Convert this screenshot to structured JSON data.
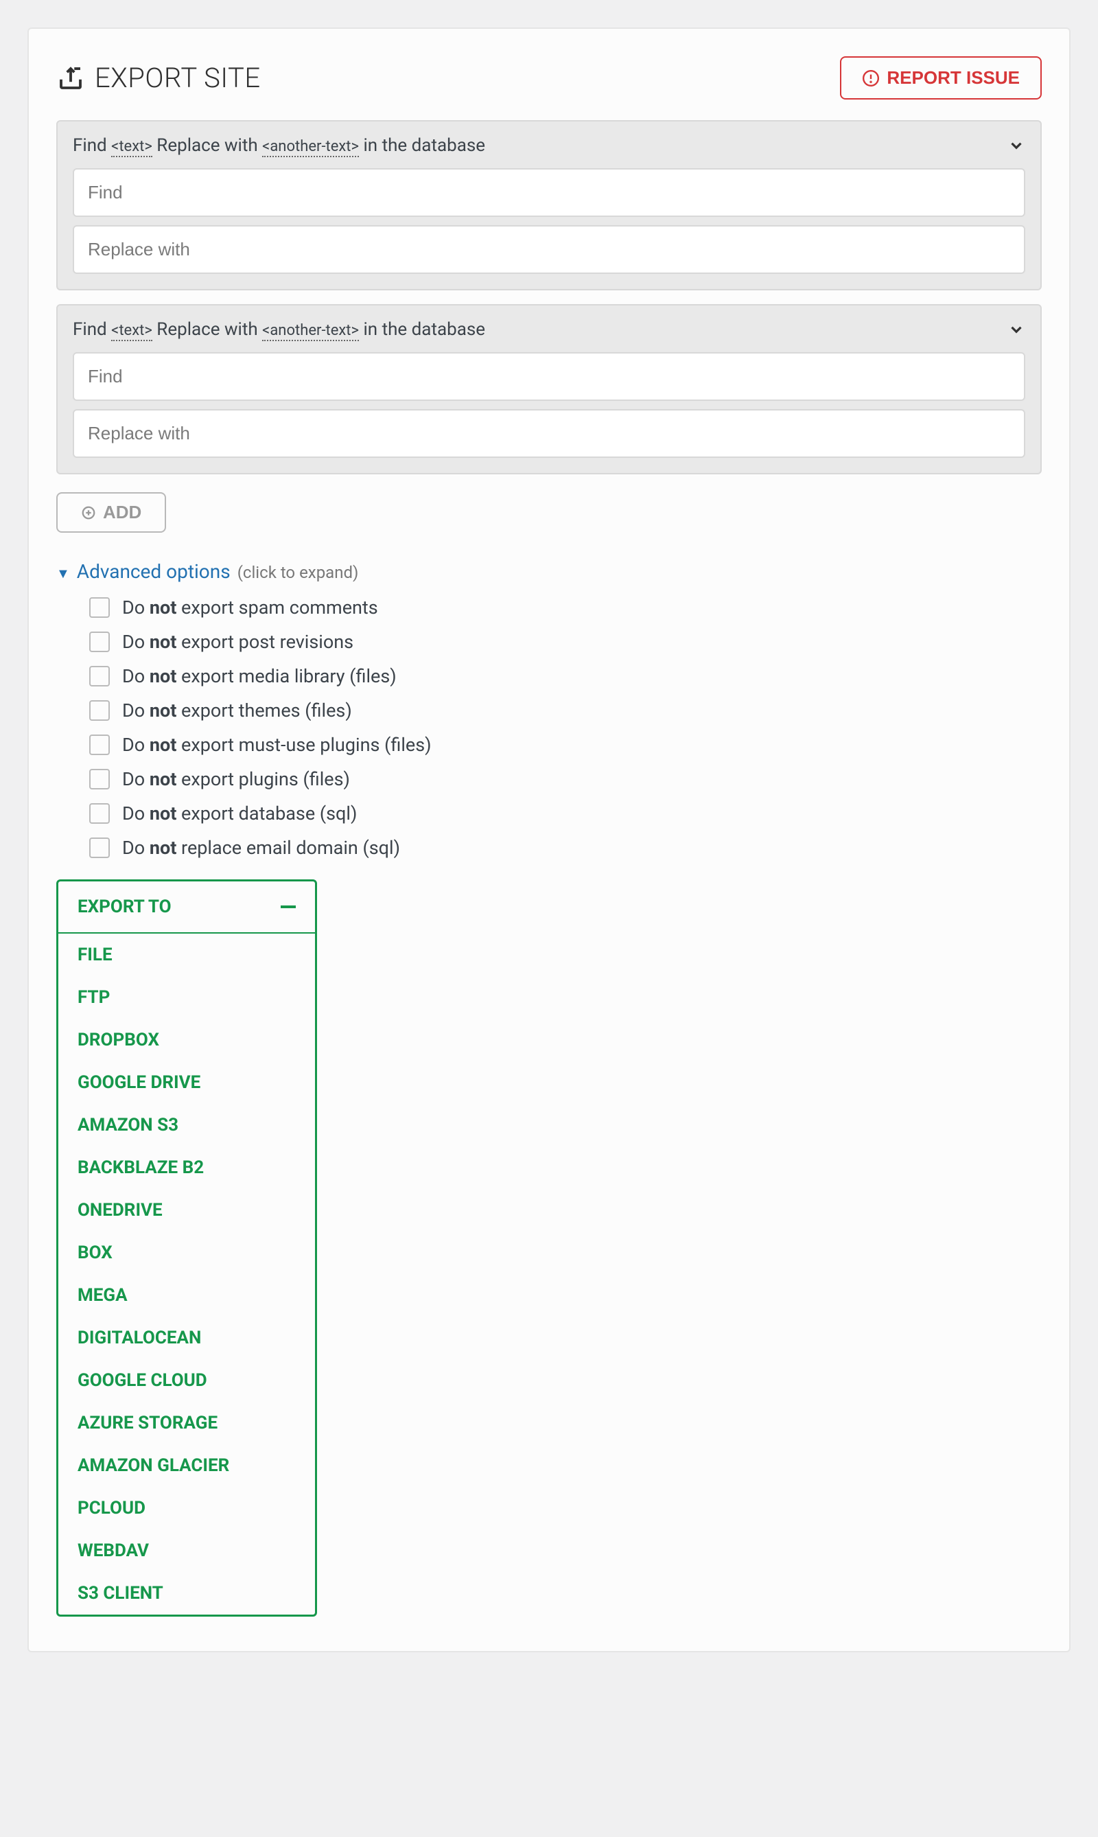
{
  "header": {
    "title": "EXPORT SITE",
    "report_label": "REPORT ISSUE"
  },
  "findreplace": {
    "label_find": "Find",
    "label_ph_text": "<text>",
    "label_replace": "Replace with",
    "label_ph_another": "<another-text>",
    "label_tail": "in the database",
    "placeholder_find": "Find",
    "placeholder_replace": "Replace with"
  },
  "add_label": "ADD",
  "advanced": {
    "label": "Advanced options",
    "hint": "(click to expand)",
    "options": [
      {
        "pre": "Do ",
        "bold": "not",
        "post": " export spam comments"
      },
      {
        "pre": "Do ",
        "bold": "not",
        "post": " export post revisions"
      },
      {
        "pre": "Do ",
        "bold": "not",
        "post": " export media library (files)"
      },
      {
        "pre": "Do ",
        "bold": "not",
        "post": " export themes (files)"
      },
      {
        "pre": "Do ",
        "bold": "not",
        "post": " export must-use plugins (files)"
      },
      {
        "pre": "Do ",
        "bold": "not",
        "post": " export plugins (files)"
      },
      {
        "pre": "Do ",
        "bold": "not",
        "post": " export database (sql)"
      },
      {
        "pre": "Do ",
        "bold": "not",
        "post": " replace email domain (sql)"
      }
    ]
  },
  "export_menu": {
    "header": "EXPORT TO",
    "items": [
      "FILE",
      "FTP",
      "DROPBOX",
      "GOOGLE DRIVE",
      "AMAZON S3",
      "BACKBLAZE B2",
      "ONEDRIVE",
      "BOX",
      "MEGA",
      "DIGITALOCEAN",
      "GOOGLE CLOUD",
      "AZURE STORAGE",
      "AMAZON GLACIER",
      "PCLOUD",
      "WEBDAV",
      "S3 CLIENT"
    ]
  }
}
